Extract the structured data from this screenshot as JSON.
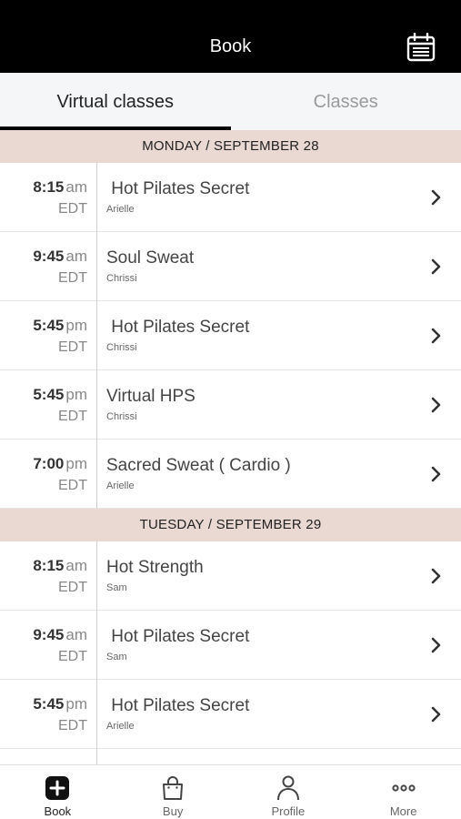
{
  "header": {
    "title": "Book",
    "calendar_icon": "calendar-icon"
  },
  "tabs": [
    {
      "label": "Virtual classes",
      "active": true
    },
    {
      "label": "Classes",
      "active": false
    }
  ],
  "days": [
    {
      "label": "MONDAY / SEPTEMBER 28",
      "classes": [
        {
          "time": "8:15",
          "ampm": "am",
          "tz": "EDT",
          "name": " Hot Pilates Secret",
          "instructor": "Arielle"
        },
        {
          "time": "9:45",
          "ampm": "am",
          "tz": "EDT",
          "name": "Soul Sweat",
          "instructor": "Chrissi"
        },
        {
          "time": "5:45",
          "ampm": "pm",
          "tz": "EDT",
          "name": " Hot Pilates Secret",
          "instructor": "Chrissi"
        },
        {
          "time": "5:45",
          "ampm": "pm",
          "tz": "EDT",
          "name": "Virtual HPS",
          "instructor": "Chrissi"
        },
        {
          "time": "7:00",
          "ampm": "pm",
          "tz": "EDT",
          "name": "Sacred Sweat ( Cardio )",
          "instructor": "Arielle"
        }
      ]
    },
    {
      "label": "TUESDAY / SEPTEMBER 29",
      "classes": [
        {
          "time": "8:15",
          "ampm": "am",
          "tz": "EDT",
          "name": "Hot Strength",
          "instructor": "Sam"
        },
        {
          "time": "9:45",
          "ampm": "am",
          "tz": "EDT",
          "name": " Hot Pilates Secret",
          "instructor": "Sam"
        },
        {
          "time": "5:45",
          "ampm": "pm",
          "tz": "EDT",
          "name": " Hot Pilates Secret",
          "instructor": "Arielle"
        }
      ]
    }
  ],
  "bottom_nav": [
    {
      "label": "Book",
      "icon": "plus-square-icon",
      "active": true
    },
    {
      "label": "Buy",
      "icon": "shopping-bag-icon",
      "active": false
    },
    {
      "label": "Profile",
      "icon": "person-icon",
      "active": false
    },
    {
      "label": "More",
      "icon": "more-dots-icon",
      "active": false
    }
  ]
}
